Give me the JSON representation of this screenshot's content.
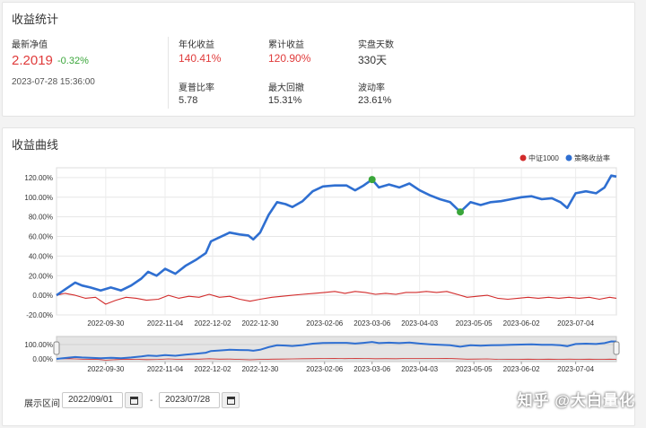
{
  "stats": {
    "title": "收益统计",
    "latest_nav_label": "最新净值",
    "latest_nav": "2.2019",
    "latest_change": "-0.32%",
    "timestamp": "2023-07-28 15:36:00",
    "annual_return_label": "年化收益",
    "annual_return": "140.41%",
    "cum_return_label": "累计收益",
    "cum_return": "120.90%",
    "live_days_label": "实盘天数",
    "live_days": "330天",
    "sharpe_label": "夏普比率",
    "sharpe": "5.78",
    "max_dd_label": "最大回撤",
    "max_dd": "15.31%",
    "volatility_label": "波动率",
    "volatility": "23.61%"
  },
  "curve": {
    "title": "收益曲线",
    "range_label": "展示区间",
    "start_date": "2022/09/01",
    "end_date": "2023/07/28",
    "dash": "-"
  },
  "watermark": "知乎 @大白量化",
  "colors": {
    "strategy": "#2f6fd1",
    "benchmark": "#d22b2b",
    "marker": "#3aa63a"
  },
  "chart_data": {
    "type": "line",
    "x_ticks": [
      "2022-09-30",
      "2022-11-04",
      "2022-12-02",
      "2022-12-30",
      "2023-02-06",
      "2023-03-06",
      "2023-04-03",
      "2023-05-05",
      "2023-06-02",
      "2023-07-04"
    ],
    "y_ticks": [
      "120.00%",
      "100.00%",
      "80.00%",
      "60.00%",
      "40.00%",
      "20.00%",
      "0.00%",
      "-20.00%"
    ],
    "nav_y_ticks": [
      "100.00%",
      "0.00%"
    ],
    "ylim": [
      -20,
      130
    ],
    "legend": [
      "中证1000",
      "策略收益率"
    ],
    "legend_position": "top-right",
    "x_start": "2022-09-01",
    "x_end": "2023-07-28",
    "series": [
      {
        "name": "策略收益率",
        "points": [
          [
            "2022-09-01",
            0
          ],
          [
            "2022-09-06",
            6
          ],
          [
            "2022-09-12",
            13
          ],
          [
            "2022-09-16",
            10
          ],
          [
            "2022-09-21",
            8
          ],
          [
            "2022-09-27",
            5
          ],
          [
            "2022-10-03",
            8
          ],
          [
            "2022-10-09",
            5
          ],
          [
            "2022-10-15",
            10
          ],
          [
            "2022-10-21",
            17
          ],
          [
            "2022-10-25",
            24
          ],
          [
            "2022-10-30",
            20
          ],
          [
            "2022-11-04",
            27
          ],
          [
            "2022-11-10",
            22
          ],
          [
            "2022-11-16",
            30
          ],
          [
            "2022-11-22",
            36
          ],
          [
            "2022-11-28",
            43
          ],
          [
            "2022-12-01",
            55
          ],
          [
            "2022-12-06",
            59
          ],
          [
            "2022-12-12",
            64
          ],
          [
            "2022-12-18",
            62
          ],
          [
            "2022-12-23",
            61
          ],
          [
            "2022-12-26",
            57
          ],
          [
            "2022-12-30",
            64
          ],
          [
            "2023-01-04",
            82
          ],
          [
            "2023-01-09",
            95
          ],
          [
            "2023-01-14",
            93
          ],
          [
            "2023-01-18",
            90
          ],
          [
            "2023-01-24",
            96
          ],
          [
            "2023-01-30",
            106
          ],
          [
            "2023-02-05",
            111
          ],
          [
            "2023-02-12",
            112
          ],
          [
            "2023-02-19",
            112
          ],
          [
            "2023-02-24",
            107
          ],
          [
            "2023-03-01",
            112
          ],
          [
            "2023-03-06",
            118
          ],
          [
            "2023-03-10",
            110
          ],
          [
            "2023-03-16",
            113
          ],
          [
            "2023-03-22",
            110
          ],
          [
            "2023-03-28",
            114
          ],
          [
            "2023-04-03",
            107
          ],
          [
            "2023-04-09",
            102
          ],
          [
            "2023-04-15",
            98
          ],
          [
            "2023-04-21",
            95
          ],
          [
            "2023-04-27",
            85
          ],
          [
            "2023-05-03",
            95
          ],
          [
            "2023-05-09",
            92
          ],
          [
            "2023-05-15",
            95
          ],
          [
            "2023-05-21",
            96
          ],
          [
            "2023-05-27",
            98
          ],
          [
            "2023-06-02",
            100
          ],
          [
            "2023-06-08",
            101
          ],
          [
            "2023-06-14",
            98
          ],
          [
            "2023-06-20",
            99
          ],
          [
            "2023-06-25",
            95
          ],
          [
            "2023-06-29",
            89
          ],
          [
            "2023-07-04",
            104
          ],
          [
            "2023-07-10",
            106
          ],
          [
            "2023-07-16",
            104
          ],
          [
            "2023-07-21",
            110
          ],
          [
            "2023-07-25",
            122
          ],
          [
            "2023-07-28",
            121
          ]
        ]
      },
      {
        "name": "中证1000",
        "points": [
          [
            "2022-09-01",
            0
          ],
          [
            "2022-09-06",
            2
          ],
          [
            "2022-09-12",
            0
          ],
          [
            "2022-09-18",
            -3
          ],
          [
            "2022-09-24",
            -2
          ],
          [
            "2022-09-30",
            -9
          ],
          [
            "2022-10-06",
            -5
          ],
          [
            "2022-10-12",
            -2
          ],
          [
            "2022-10-18",
            -3
          ],
          [
            "2022-10-24",
            -5
          ],
          [
            "2022-10-31",
            -4
          ],
          [
            "2022-11-06",
            0
          ],
          [
            "2022-11-12",
            -3
          ],
          [
            "2022-11-18",
            -1
          ],
          [
            "2022-11-24",
            -2
          ],
          [
            "2022-11-30",
            1
          ],
          [
            "2022-12-06",
            -2
          ],
          [
            "2022-12-12",
            -1
          ],
          [
            "2022-12-18",
            -4
          ],
          [
            "2022-12-24",
            -6
          ],
          [
            "2022-12-30",
            -4
          ],
          [
            "2023-01-06",
            -2
          ],
          [
            "2023-01-12",
            -1
          ],
          [
            "2023-01-18",
            0
          ],
          [
            "2023-01-24",
            1
          ],
          [
            "2023-01-31",
            2
          ],
          [
            "2023-02-06",
            3
          ],
          [
            "2023-02-12",
            4
          ],
          [
            "2023-02-18",
            2
          ],
          [
            "2023-02-24",
            4
          ],
          [
            "2023-03-02",
            3
          ],
          [
            "2023-03-08",
            1
          ],
          [
            "2023-03-14",
            2
          ],
          [
            "2023-03-20",
            1
          ],
          [
            "2023-03-26",
            3
          ],
          [
            "2023-04-01",
            3
          ],
          [
            "2023-04-07",
            4
          ],
          [
            "2023-04-13",
            3
          ],
          [
            "2023-04-19",
            4
          ],
          [
            "2023-04-25",
            1
          ],
          [
            "2023-05-01",
            -2
          ],
          [
            "2023-05-07",
            -1
          ],
          [
            "2023-05-13",
            0
          ],
          [
            "2023-05-19",
            -3
          ],
          [
            "2023-05-25",
            -4
          ],
          [
            "2023-05-31",
            -3
          ],
          [
            "2023-06-06",
            -2
          ],
          [
            "2023-06-12",
            -3
          ],
          [
            "2023-06-18",
            -2
          ],
          [
            "2023-06-24",
            -3
          ],
          [
            "2023-06-30",
            -2
          ],
          [
            "2023-07-06",
            -3
          ],
          [
            "2023-07-12",
            -2
          ],
          [
            "2023-07-18",
            -4
          ],
          [
            "2023-07-24",
            -2
          ],
          [
            "2023-07-28",
            -3
          ]
        ]
      }
    ],
    "markers": [
      {
        "date": "2023-03-06",
        "value": 118
      },
      {
        "date": "2023-04-27",
        "value": 85
      }
    ]
  }
}
